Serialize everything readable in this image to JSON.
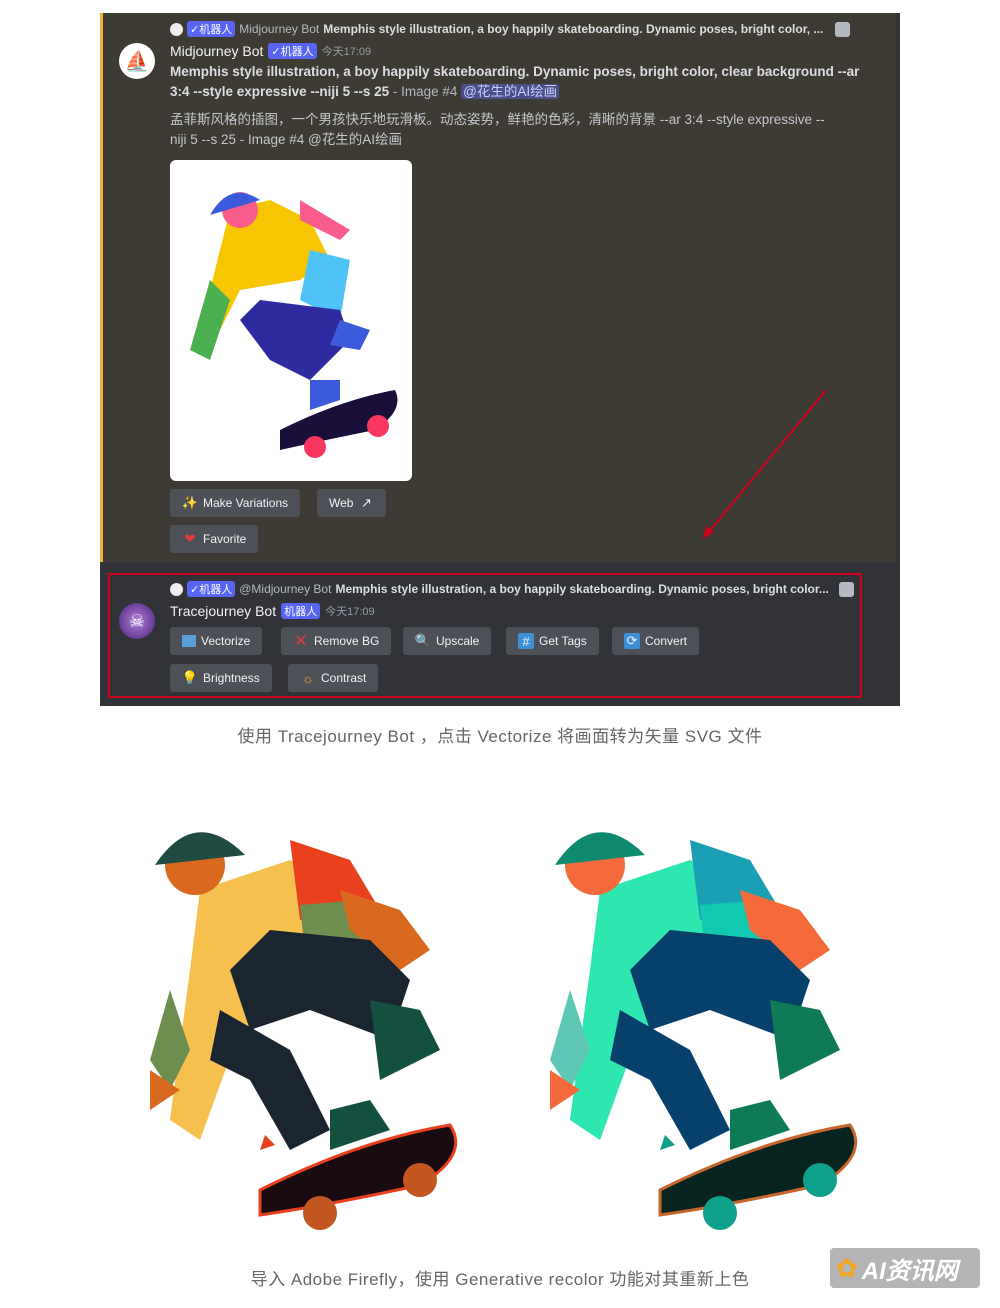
{
  "message1": {
    "reply_badge": "✓机器人",
    "reply_author": "Midjourney Bot",
    "reply_text": "Memphis style illustration, a boy happily skateboarding. Dynamic poses, bright color, ...",
    "author": "Midjourney Bot",
    "badge": "✓机器人",
    "time": "今天17:09",
    "prompt_bold": "Memphis style illustration, a boy happily skateboarding. Dynamic poses, bright color, clear background --ar 3:4 --style expressive --niji 5 --s 25",
    "prompt_suffix": " - Image #4 ",
    "mention": "@花生的AI绘画",
    "translation": "孟菲斯风格的插图，一个男孩快乐地玩滑板。动态姿势，鲜艳的色彩，清晰的背景 --ar 3:4 --style expressive --niji 5 --s 25 - Image #4 @花生的AI绘画",
    "buttons": [
      "Make Variations",
      "Web",
      "Favorite"
    ]
  },
  "message2": {
    "reply_badge": "✓机器人",
    "reply_author": "@Midjourney Bot",
    "reply_text": "Memphis style illustration, a boy happily skateboarding. Dynamic poses, bright color...",
    "author": "Tracejourney Bot",
    "badge": "机器人",
    "time": "今天17:09",
    "buttons": [
      "Vectorize",
      "Remove BG",
      "Upscale",
      "Get Tags",
      "Convert",
      "Brightness",
      "Contrast"
    ]
  },
  "caption1": "使用 Tracejourney Bot ，点击 Vectorize 将画面转为矢量 SVG 文件",
  "caption2": "导入 Adobe Firefly，使用 Generative recolor 功能对其重新上色",
  "watermark": "AI资讯网",
  "colors": {
    "highlight_border": "#f0b232",
    "annotation_red": "#d0021b",
    "bot_badge": "#5865f2"
  }
}
